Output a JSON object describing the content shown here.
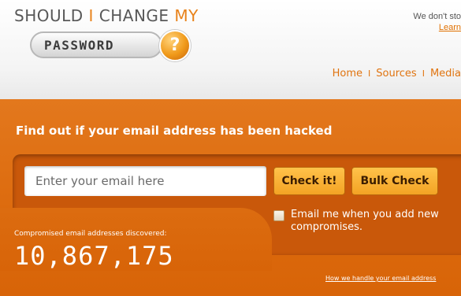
{
  "logo": {
    "line1_part1": "SHOULD ",
    "line1_accent1": "I",
    "line1_part2": " CHANGE ",
    "line1_accent2": "MY",
    "pill_text": "PASSWORD",
    "badge_glyph": "?",
    "accent_color": "#e8821a"
  },
  "header_note": {
    "text": "We don't sto",
    "link": "Learn"
  },
  "nav": {
    "items": [
      "Home",
      "Sources",
      "Media"
    ],
    "separator": "I"
  },
  "hero": {
    "title": "Find out if your email address has been hacked",
    "email_placeholder": "Enter your email here",
    "check_button": "Check it!",
    "bulk_button": "Bulk Check",
    "notify_label": "Email me when you add new compromises.",
    "stat_label": "Compromised email addresses discovered:",
    "stat_value": "10,867,175",
    "privacy_link": "How we handle your email address",
    "background_color": "#dc6a0d"
  }
}
